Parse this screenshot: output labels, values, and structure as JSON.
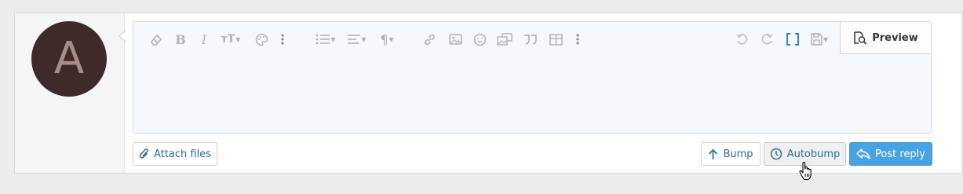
{
  "avatar": {
    "letter": "A",
    "bg": "#3e2a28",
    "fg": "#a88d88"
  },
  "toolbar": {
    "left_icons": [
      "eraser-icon",
      "bold-icon",
      "italic-icon",
      "text-size-icon",
      "palette-icon",
      "more-vertical-icon",
      "list-icon",
      "align-icon",
      "paragraph-icon",
      "link-icon",
      "image-icon",
      "smiley-icon",
      "media-icon",
      "quote-icon",
      "table-icon",
      "more-vertical-icon"
    ],
    "right_icons": [
      "undo-icon",
      "redo-icon",
      "bbcode-icon",
      "drafts-icon"
    ],
    "preview_label": "Preview"
  },
  "editor": {
    "value": ""
  },
  "actions": {
    "attach_label": "Attach files",
    "bump_label": "Bump",
    "autobump_label": "Autobump",
    "post_label": "Post reply"
  },
  "colors": {
    "accent": "#48a3e2",
    "link": "#2c6aa0",
    "editor_bg": "#f5f9fd"
  }
}
